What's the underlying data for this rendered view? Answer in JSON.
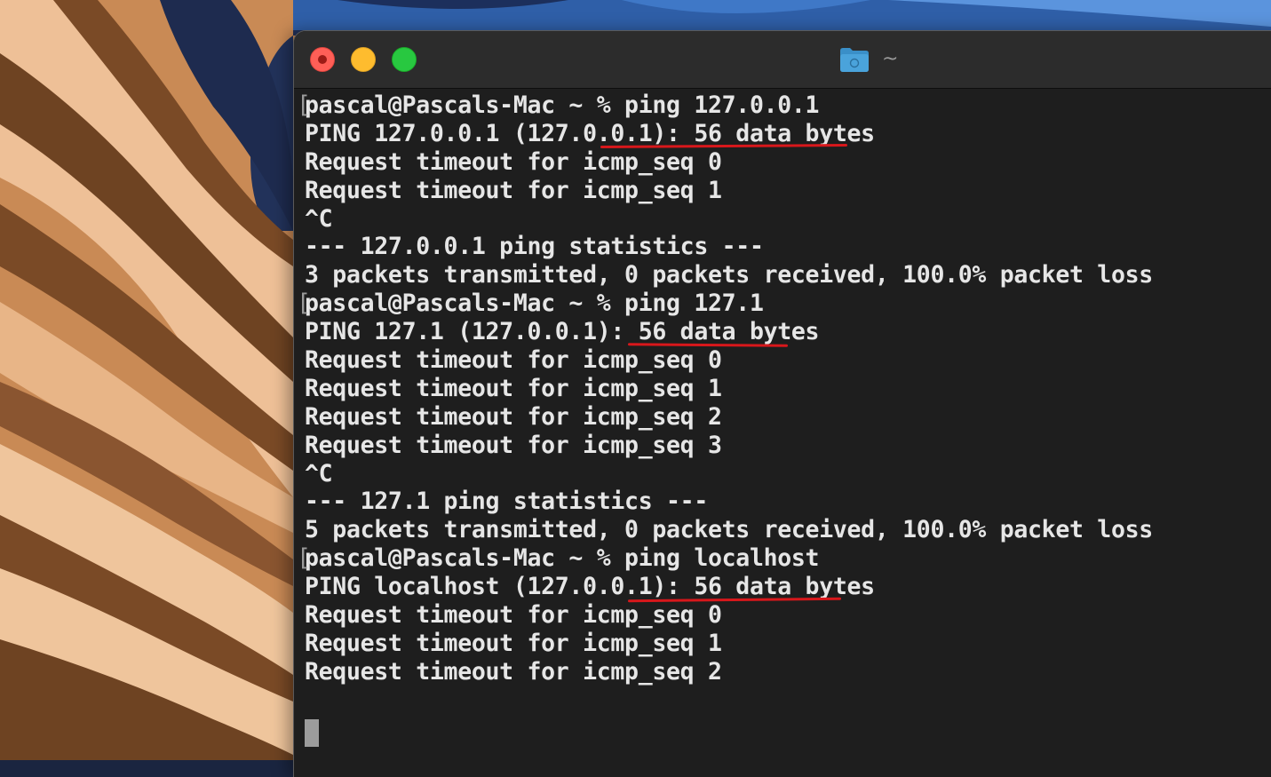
{
  "window": {
    "title": "~",
    "title_icon": "folder-icon",
    "traffic_lights": {
      "close_color": "#ff5f57",
      "minimize_color": "#febc2e",
      "maximize_color": "#28c840"
    }
  },
  "terminal": {
    "prompt_marker": "[",
    "lines": [
      "pascal@Pascals-Mac ~ % ping 127.0.0.1",
      "PING 127.0.0.1 (127.0.0.1): 56 data bytes",
      "Request timeout for icmp_seq 0",
      "Request timeout for icmp_seq 1",
      "^C",
      "--- 127.0.0.1 ping statistics ---",
      "3 packets transmitted, 0 packets received, 100.0% packet loss",
      "pascal@Pascals-Mac ~ % ping 127.1",
      "PING 127.1 (127.0.0.1): 56 data bytes",
      "Request timeout for icmp_seq 0",
      "Request timeout for icmp_seq 1",
      "Request timeout for icmp_seq 2",
      "Request timeout for icmp_seq 3",
      "^C",
      "--- 127.1 ping statistics ---",
      "5 packets transmitted, 0 packets received, 100.0% packet loss",
      "pascal@Pascals-Mac ~ % ping localhost",
      "PING localhost (127.0.0.1): 56 data bytes",
      "Request timeout for icmp_seq 0",
      "Request timeout for icmp_seq 1",
      "Request timeout for icmp_seq 2"
    ],
    "annotation_color": "#d8171b",
    "text_color": "#e6e6e6",
    "background_color": "#1e1e1e"
  }
}
